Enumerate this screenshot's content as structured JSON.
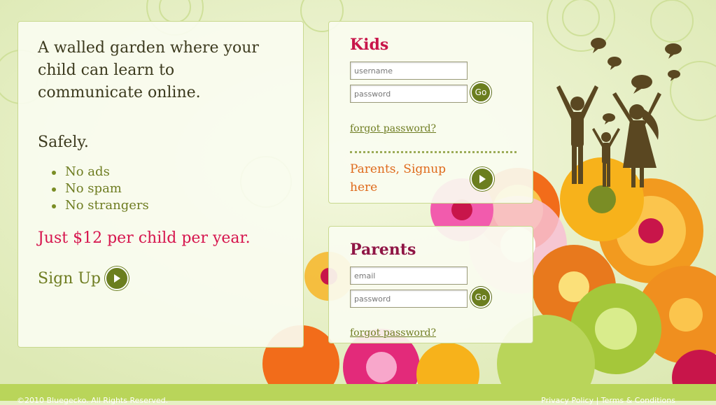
{
  "intro": {
    "headline": "A walled garden where your child can learn to communicate online.",
    "safely": "Safely.",
    "bullets": [
      "No ads",
      "No spam",
      "No strangers"
    ],
    "price": "Just $12 per child per year.",
    "signup_label": "Sign Up"
  },
  "kids": {
    "title": "Kids",
    "username_placeholder": "username",
    "password_placeholder": "password",
    "go_label": "Go",
    "forgot_label": "forgot password?",
    "parent_signup_label": "Parents, Signup here"
  },
  "parents": {
    "title": "Parents",
    "email_placeholder": "email",
    "password_placeholder": "password",
    "go_label": "Go",
    "forgot_label": "forgot password?"
  },
  "footer": {
    "copyright": "©2010 Bluegecko. All Rights Reserved.",
    "links": "Privacy Policy | Terms & Conditions"
  },
  "colors": {
    "background": "#e6f0c4",
    "accent_green": "#6b7e1f",
    "pink": "#d6144d",
    "orange": "#df6a1c",
    "footer": "#b9d55a"
  },
  "icons": [
    "arrow-right-icon",
    "speech-bubble-icon",
    "family-silhouette",
    "flower-decoration"
  ]
}
